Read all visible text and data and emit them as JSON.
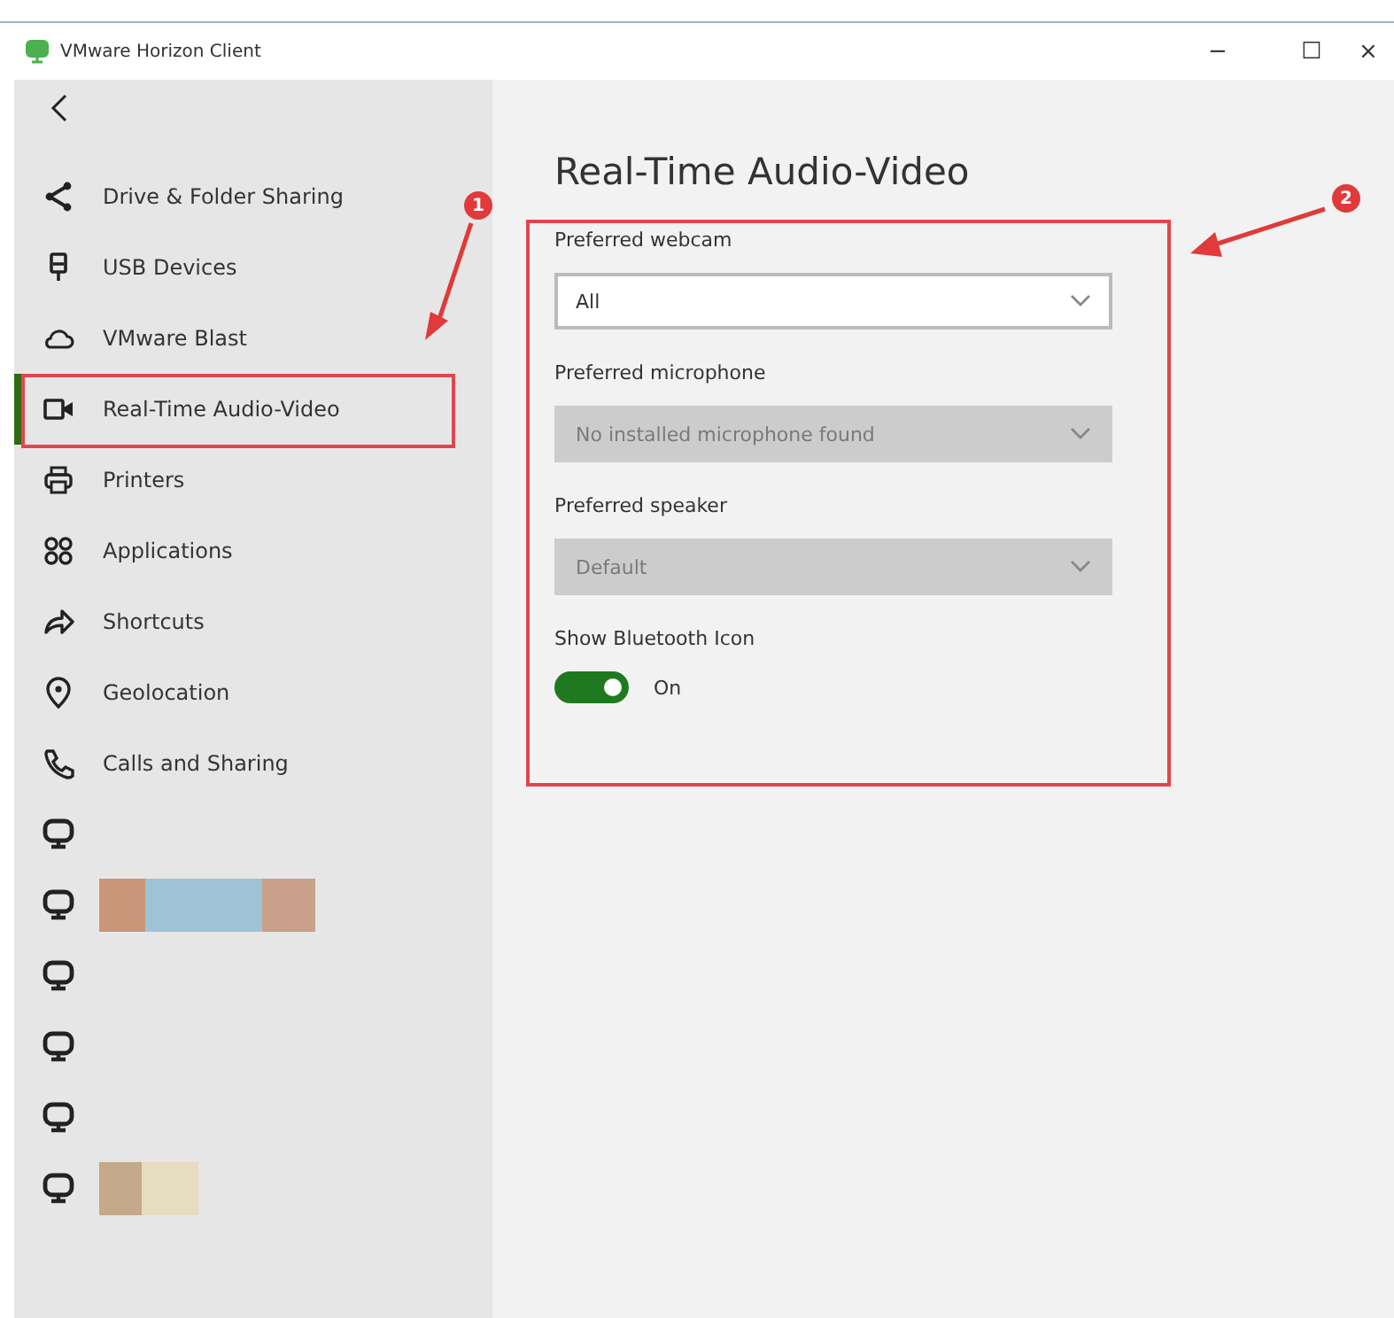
{
  "window": {
    "title": "VMware Horizon Client",
    "controls": [
      "−",
      "☐",
      "×"
    ]
  },
  "sidebar": {
    "items": [
      {
        "label": "Drive & Folder Sharing",
        "selected": false
      },
      {
        "label": "USB Devices",
        "selected": false
      },
      {
        "label": "VMware Blast",
        "selected": false
      },
      {
        "label": "Real-Time Audio-Video",
        "selected": true
      },
      {
        "label": "Printers",
        "selected": false
      },
      {
        "label": "Applications",
        "selected": false
      },
      {
        "label": "Shortcuts",
        "selected": false
      },
      {
        "label": "Geolocation",
        "selected": false
      },
      {
        "label": "Calls and Sharing",
        "selected": false
      }
    ],
    "desktops": [
      {
        "kind": "plain"
      },
      {
        "kind": "redacted-wide"
      },
      {
        "kind": "plain"
      },
      {
        "kind": "plain"
      },
      {
        "kind": "plain"
      },
      {
        "kind": "redacted-narrow"
      }
    ]
  },
  "page": {
    "title": "Real-Time Audio-Video",
    "settings": [
      {
        "kind": "dropdown",
        "label": "Preferred webcam",
        "value": "All",
        "disabled": false
      },
      {
        "kind": "dropdown",
        "label": "Preferred microphone",
        "value": "No installed microphone found",
        "disabled": true
      },
      {
        "kind": "dropdown",
        "label": "Preferred speaker",
        "value": "Default",
        "disabled": true
      },
      {
        "kind": "toggle",
        "label": "Show Bluetooth Icon",
        "on": true,
        "state_text": "On"
      }
    ]
  },
  "annotations": [
    {
      "label": "1"
    },
    {
      "label": "2"
    }
  ]
}
